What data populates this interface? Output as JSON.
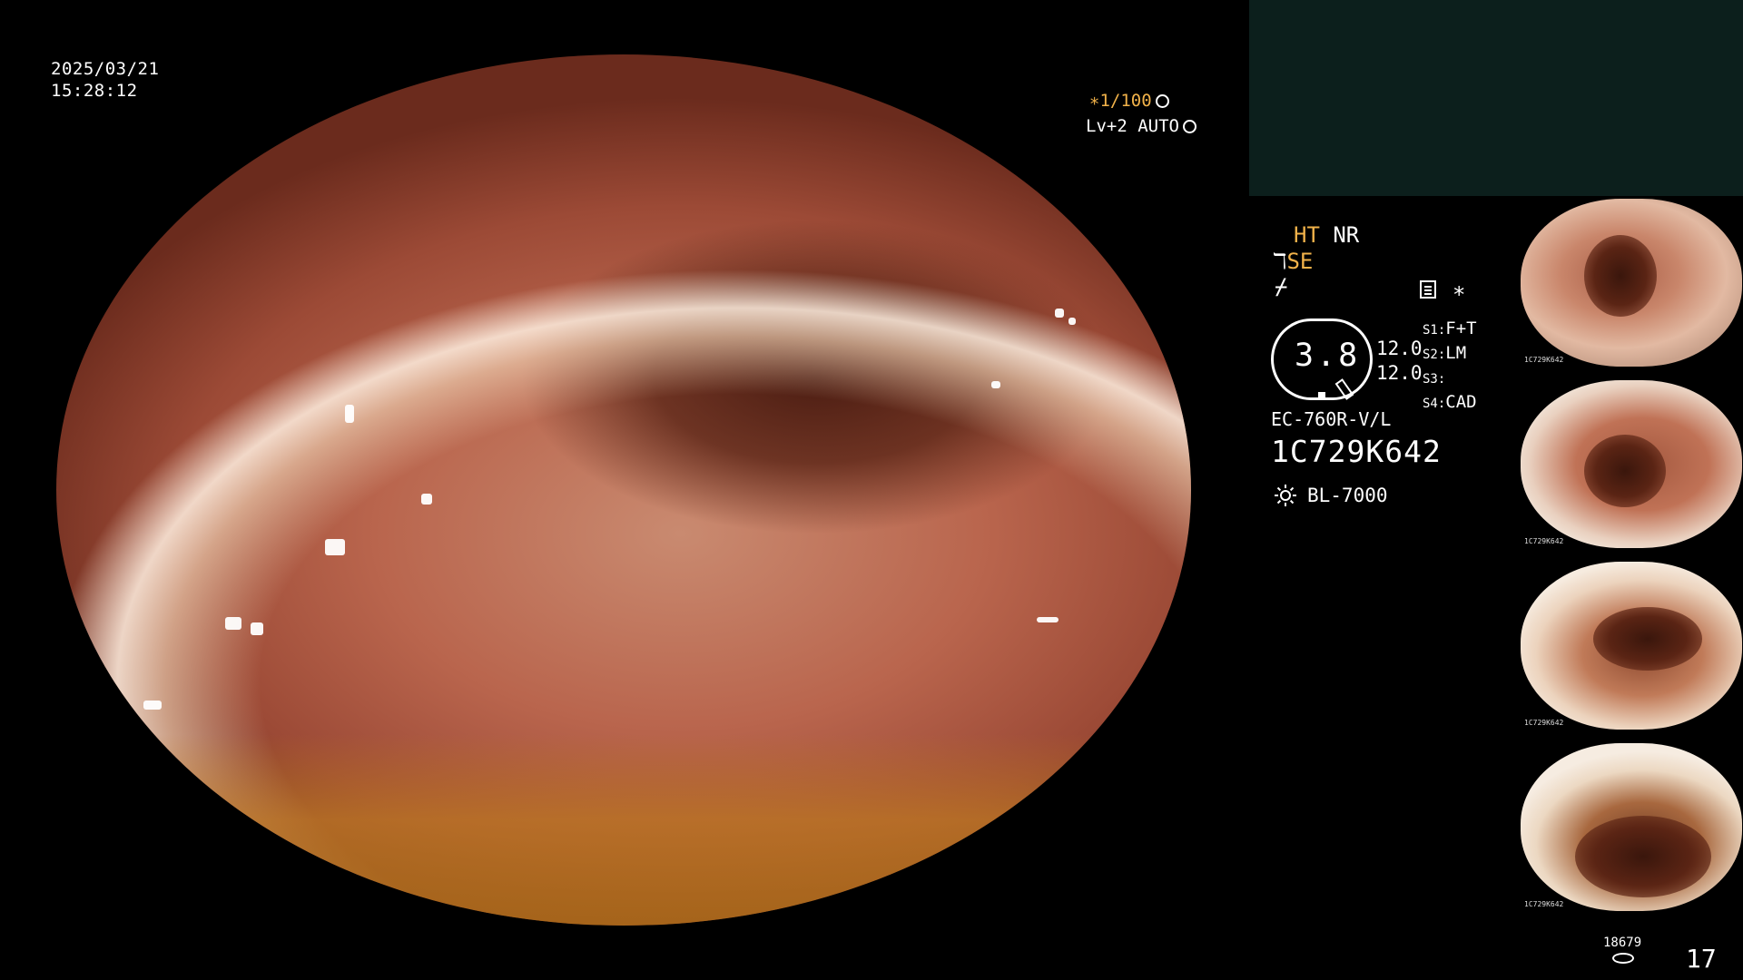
{
  "overlay": {
    "date": "2025/03/21",
    "time": "15:28:12",
    "shutter": "1/100",
    "shutter_prefix": "∗",
    "level": "Lv+2 AUTO"
  },
  "processor": {
    "ht": "HT",
    "nr": "NR",
    "se": "SE",
    "se_prefix": "ℸ",
    "slash": "⌿",
    "star": "∗",
    "gauge_value": "3.8",
    "value_a": "12.0",
    "value_b": "12.0",
    "switches": [
      {
        "key": "S1:",
        "val": "F+T"
      },
      {
        "key": "S2:",
        "val": "LM"
      },
      {
        "key": "S3:",
        "val": ""
      },
      {
        "key": "S4:",
        "val": "CAD"
      }
    ],
    "scope_model": "EC-760R-V/L",
    "serial": "1C729K642",
    "light_source": "BL-7000"
  },
  "thumbnails": [
    {
      "label": "1C729K642"
    },
    {
      "label": "1C729K642"
    },
    {
      "label": "1C729K642"
    },
    {
      "label": "1C729K642"
    }
  ],
  "footer": {
    "storage_count": "18679",
    "image_count": "17"
  },
  "colors": {
    "highlight": "#f1b24a",
    "panel": "#0c1f1c"
  },
  "icons": [
    "shutter-wheel-icon",
    "auto-iris-icon",
    "memo-icon",
    "light-source-icon",
    "storage-disk-icon"
  ]
}
